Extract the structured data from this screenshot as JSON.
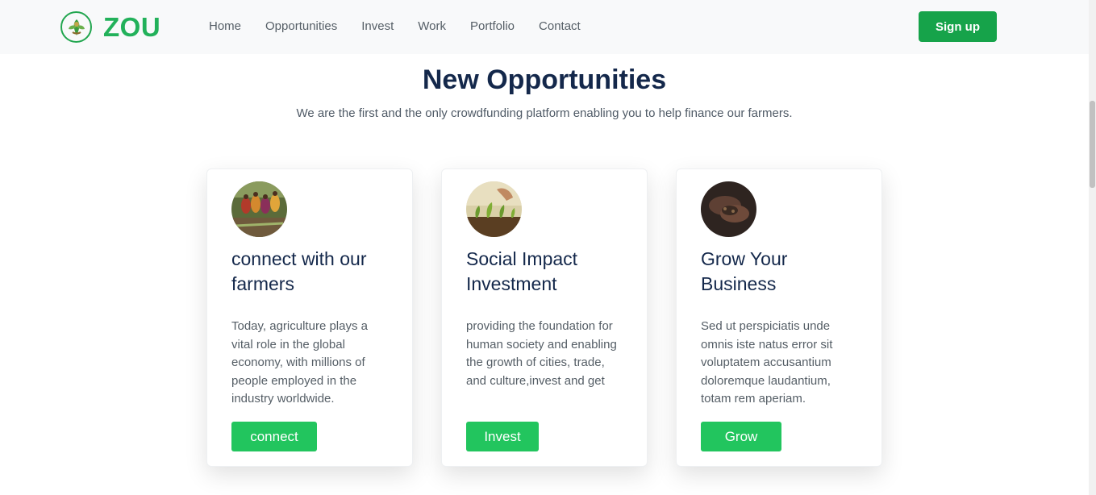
{
  "brand": {
    "name": "ZOU",
    "icon": "farmer-leaf-logo-icon",
    "color": "#22b15a"
  },
  "nav": {
    "links": [
      "Home",
      "Opportunities",
      "Invest",
      "Work",
      "Portfolio",
      "Contact"
    ],
    "signup_label": "Sign up"
  },
  "section": {
    "title": "New Opportunities",
    "subtitle": "We are the first and the only crowdfunding platform enabling you to help finance our farmers."
  },
  "cards": [
    {
      "image": "farmers-working-field-photo",
      "title": "connect with our farmers",
      "text": "Today, agriculture plays a vital role in the global economy, with millions of people employed in the industry worldwide.",
      "button": "connect"
    },
    {
      "image": "hand-planting-seedlings-photo",
      "title": "Social Impact Investment",
      "text": "providing the foundation for human society and enabling the growth of cities, trade, and culture,invest and get",
      "button": "Invest"
    },
    {
      "image": "hands-holding-soil-photo",
      "title": "Grow Your Business",
      "text": "Sed ut perspiciatis unde omnis iste natus error sit voluptatem accusantium doloremque laudantium, totam rem aperiam.",
      "button": "Grow"
    }
  ],
  "colors": {
    "accent": "#22c55e",
    "signup": "#16a34a",
    "heading": "#14284b"
  }
}
